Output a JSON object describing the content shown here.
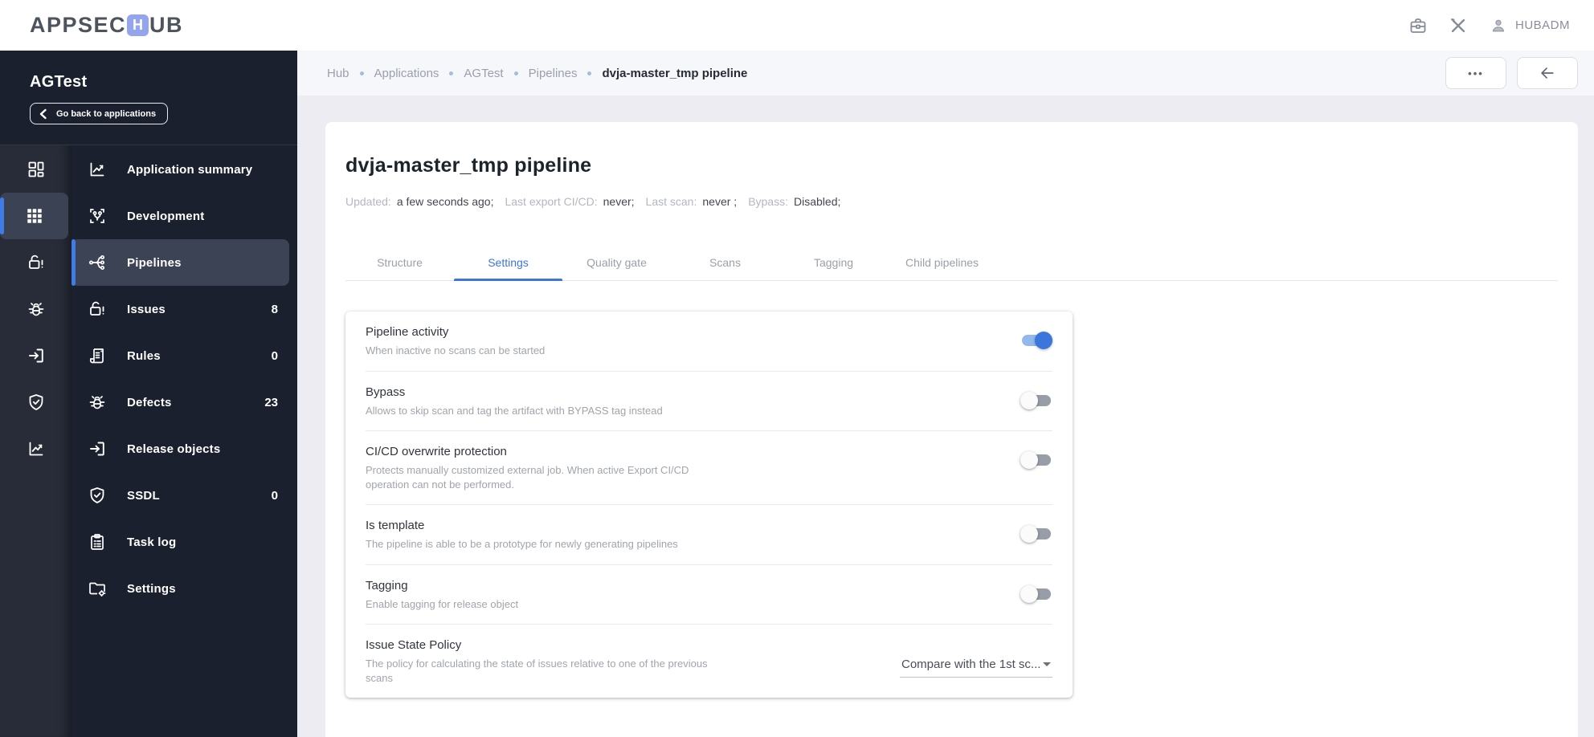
{
  "topbar": {
    "logo": {
      "part1": "APPSEC",
      "tile_letter": "H",
      "part2": "UB"
    },
    "icons": [
      "briefcase-icon",
      "tools-icon",
      "person-icon"
    ],
    "user": "HUBADM"
  },
  "breadcrumb": {
    "items": [
      "Hub",
      "Applications",
      "AGTest",
      "Pipelines"
    ],
    "current": "dvja-master_tmp pipeline"
  },
  "header_buttons": {
    "more_label": "•••",
    "back_icon": "arrow-left-icon"
  },
  "sidebar": {
    "app_name": "AGTest",
    "back_button": "Go back to applications",
    "rail": [
      {
        "icon": "dashboard-icon",
        "active": false
      },
      {
        "icon": "apps-grid-icon",
        "active": true
      },
      {
        "icon": "lock-alert-icon",
        "active": false
      },
      {
        "icon": "bug-icon",
        "active": false
      },
      {
        "icon": "exit-icon",
        "active": false
      },
      {
        "icon": "shield-check-icon",
        "active": false
      },
      {
        "icon": "chart-icon",
        "active": false
      }
    ],
    "items": [
      {
        "label": "Application summary",
        "icon": "chart-icon",
        "badge": "",
        "active": false
      },
      {
        "label": "Development",
        "icon": "branch-icon",
        "badge": "",
        "active": false
      },
      {
        "label": "Pipelines",
        "icon": "pipeline-icon",
        "badge": "",
        "active": true
      },
      {
        "label": "Issues",
        "icon": "lock-alert-icon",
        "badge": "8",
        "active": false
      },
      {
        "label": "Rules",
        "icon": "scroll-icon",
        "badge": "0",
        "active": false
      },
      {
        "label": "Defects",
        "icon": "bug-icon",
        "badge": "23",
        "active": false
      },
      {
        "label": "Release objects",
        "icon": "exit-icon",
        "badge": "",
        "active": false
      },
      {
        "label": "SSDL",
        "icon": "shield-check-icon",
        "badge": "0",
        "active": false
      },
      {
        "label": "Task log",
        "icon": "clipboard-icon",
        "badge": "",
        "active": false
      },
      {
        "label": "Settings",
        "icon": "folder-gear-icon",
        "badge": "",
        "active": false
      }
    ]
  },
  "page": {
    "title": "dvja-master_tmp pipeline",
    "meta": [
      {
        "label": "Updated:",
        "value": "a few seconds ago;"
      },
      {
        "label": "Last export CI/CD:",
        "value": "never;"
      },
      {
        "label": "Last scan:",
        "value": "never ;"
      },
      {
        "label": "Bypass:",
        "value": "Disabled;"
      }
    ],
    "tabs": [
      {
        "label": "Structure",
        "active": false
      },
      {
        "label": "Settings",
        "active": true
      },
      {
        "label": "Quality gate",
        "active": false
      },
      {
        "label": "Scans",
        "active": false
      },
      {
        "label": "Tagging",
        "active": false
      },
      {
        "label": "Child pipelines",
        "active": false
      }
    ],
    "settings": [
      {
        "title": "Pipeline activity",
        "desc": "When inactive no scans can be started",
        "control": "toggle",
        "on": true
      },
      {
        "title": "Bypass",
        "desc": "Allows to skip scan and tag the artifact with BYPASS tag instead",
        "control": "toggle",
        "on": false
      },
      {
        "title": "CI/CD overwrite protection",
        "desc": "Protects manually customized external job. When active Export CI/CD operation can not be performed.",
        "control": "toggle",
        "on": false
      },
      {
        "title": "Is template",
        "desc": "The pipeline is able to be a prototype for newly generating pipelines",
        "control": "toggle",
        "on": false
      },
      {
        "title": "Tagging",
        "desc": "Enable tagging for release object",
        "control": "toggle",
        "on": false
      },
      {
        "title": "Issue State Policy",
        "desc": "The policy for calculating the state of issues relative to one of the previous scans",
        "control": "select",
        "value": "Compare with the 1st sc..."
      }
    ]
  },
  "colors": {
    "accent_blue": "#3d74e0",
    "toggle_on_track": "#93b7ef",
    "toggle_on_knob": "#3b76dc",
    "sidebar_bg": "#1a202d",
    "sidebar_active": "#3c4354",
    "logo_tile": "#94a5ee"
  }
}
